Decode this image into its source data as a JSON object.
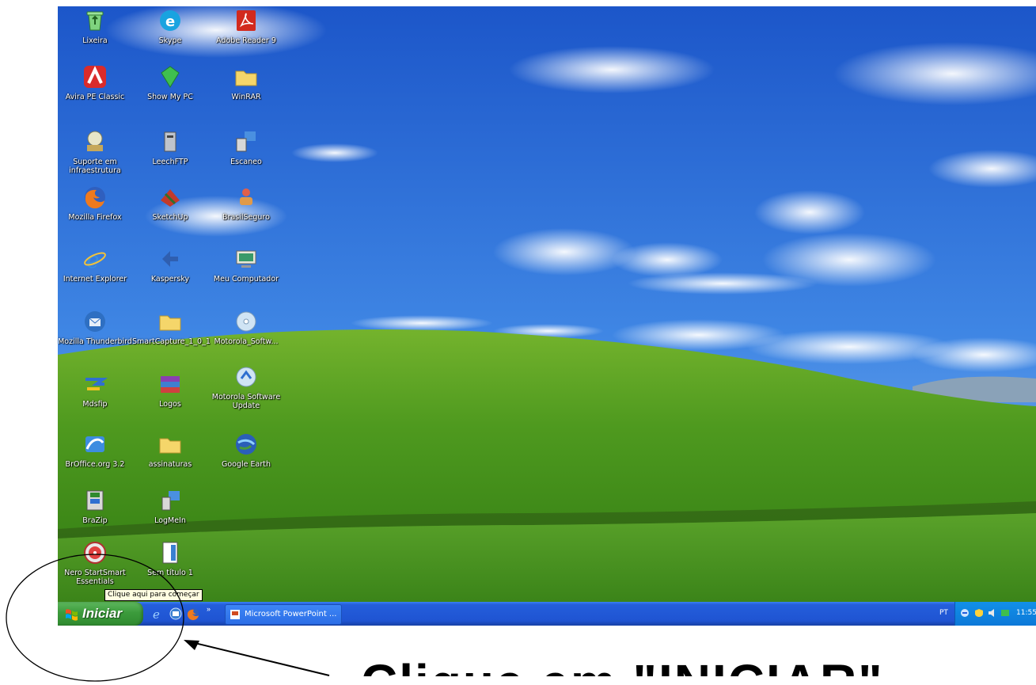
{
  "desktop": {
    "icons": [
      {
        "label": "Lixeira",
        "icon": "recycle-bin-icon"
      },
      {
        "label": "Avira PE Classic",
        "icon": "avira-icon"
      },
      {
        "label": "Suporte em infraestrutura",
        "icon": "support-icon"
      },
      {
        "label": "Mozilla Firefox",
        "icon": "firefox-icon"
      },
      {
        "label": "Internet Explorer",
        "icon": "internet-explorer-icon"
      },
      {
        "label": "Mozilla Thunderbird",
        "icon": "thunderbird-icon"
      },
      {
        "label": "Mdsfip",
        "icon": "app-icon"
      },
      {
        "label": "BrOffice.org 3.2",
        "icon": "broffice-icon"
      },
      {
        "label": "BraZip",
        "icon": "brazip-icon"
      },
      {
        "label": "Nero StartSmart Essentials",
        "icon": "nero-icon"
      },
      {
        "label": "Skype",
        "icon": "skype-icon"
      },
      {
        "label": "Show My PC",
        "icon": "show-my-pc-icon"
      },
      {
        "label": "LeechFTP",
        "icon": "ftp-icon"
      },
      {
        "label": "SketchUp",
        "icon": "sketchup-icon"
      },
      {
        "label": "Kaspersky",
        "icon": "kaspersky-icon"
      },
      {
        "label": "SmartCapture_1_0_1",
        "icon": "folder-icon"
      },
      {
        "label": "Logos",
        "icon": "archive-icon"
      },
      {
        "label": "assinaturas",
        "icon": "folder-icon"
      },
      {
        "label": "LogMeIn",
        "icon": "logmein-icon"
      },
      {
        "label": "Sem título 1",
        "icon": "document-icon"
      },
      {
        "label": "Adobe Reader 9",
        "icon": "adobe-reader-icon"
      },
      {
        "label": "WinRAR",
        "icon": "folder-icon"
      },
      {
        "label": "Escaneo",
        "icon": "scanner-icon"
      },
      {
        "label": "BrasilSeguro",
        "icon": "app-icon"
      },
      {
        "label": "Meu Computador",
        "icon": "my-computer-icon"
      },
      {
        "label": "Motorola_Softw...",
        "icon": "cd-icon"
      },
      {
        "label": "Motorola Software Update",
        "icon": "update-icon"
      },
      {
        "label": "Google Earth",
        "icon": "google-earth-icon"
      }
    ]
  },
  "tooltip": "Clique aqui para começar",
  "taskbar": {
    "start_label": "Iniciar",
    "quick_launch": [
      "internet-explorer-icon",
      "outlook-express-icon",
      "firefox-icon"
    ],
    "task_label": "Microsoft PowerPoint ...",
    "language": "PT",
    "clock": "11:55"
  },
  "annotation": {
    "caption": "Clique em \"INICIAR\""
  },
  "colors": {
    "taskbar_blue": "#245edb",
    "start_green": "#3c9b3c",
    "tray_blue": "#0c78d8",
    "sky": "#2b6fd6",
    "grass": "#3e8f1e"
  }
}
